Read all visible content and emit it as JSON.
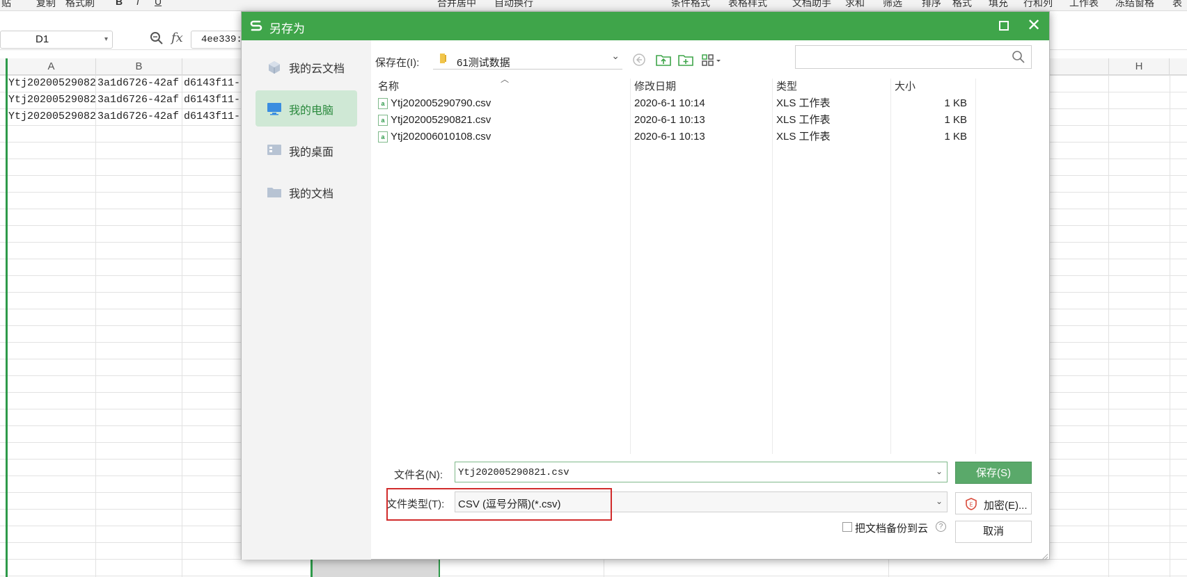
{
  "ribbon": {
    "items": [
      "贴",
      "复制",
      "格式刷",
      "B",
      "I",
      "U",
      "合并居中",
      "自动换行",
      "条件格式",
      "表格样式",
      "文档助手",
      "求和",
      "筛选",
      "排序",
      "格式",
      "填充",
      "行和列",
      "工作表",
      "冻结窗格",
      "表"
    ]
  },
  "formula_bar": {
    "cell_ref": "D1",
    "fx": "fx",
    "value": "4ee339:"
  },
  "sheet": {
    "columns": [
      "A",
      "B",
      "H"
    ],
    "rows": [
      [
        "Ytj20200529082",
        "3a1d6726-42af",
        "d6143f11-"
      ],
      [
        "Ytj20200529082",
        "3a1d6726-42af",
        "d6143f11-"
      ],
      [
        "Ytj20200529082",
        "3a1d6726-42af",
        "d6143f11-"
      ]
    ]
  },
  "dialog": {
    "title": "另存为",
    "close_symbol": "✕",
    "sidebar": [
      {
        "label": "我的云文档"
      },
      {
        "label": "我的电脑"
      },
      {
        "label": "我的桌面"
      },
      {
        "label": "我的文档"
      }
    ],
    "location_label": "保存在(I):",
    "location_value": "61测试数据",
    "columns": {
      "name": "名称",
      "modified": "修改日期",
      "type": "类型",
      "size": "大小"
    },
    "files": [
      {
        "name": "Ytj202005290790.csv",
        "modified": "2020-6-1 10:14",
        "type": "XLS 工作表",
        "size": "1 KB"
      },
      {
        "name": "Ytj202005290821.csv",
        "modified": "2020-6-1 10:13",
        "type": "XLS 工作表",
        "size": "1 KB"
      },
      {
        "name": "Ytj202006010108.csv",
        "modified": "2020-6-1 10:13",
        "type": "XLS 工作表",
        "size": "1 KB"
      }
    ],
    "filename_label": "文件名(N):",
    "filename_value": "Ytj202005290821.csv",
    "filetype_label": "文件类型(T):",
    "filetype_value": "CSV (逗号分隔)(*.csv)",
    "save_label": "保存(S)",
    "encrypt_label": "加密(E)...",
    "cancel_label": "取消",
    "backup_label": "把文档备份到云",
    "help_symbol": "?"
  },
  "colors": {
    "accent": "#3fa54a",
    "sidebar_active": "#cfe8d5",
    "highlight": "#d12b2b"
  }
}
